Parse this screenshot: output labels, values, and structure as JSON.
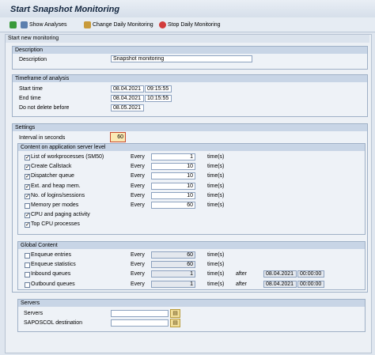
{
  "title": "Start Snapshot Monitoring",
  "toolbar": {
    "show_analyses": "Show Analyses",
    "change_daily": "Change Daily Monitoring",
    "stop_daily": "Stop Daily Monitoring"
  },
  "panel_header": "Start new monitoring",
  "description": {
    "group": "Description",
    "label": "Description",
    "value": "Snapshot monitoring"
  },
  "timeframe": {
    "group": "Timeframe of analysis",
    "start_label": "Start time",
    "start_date": "08.04.2021",
    "start_time": "09:15:55",
    "end_label": "End time",
    "end_date": "08.04.2021",
    "end_time": "10:15:55",
    "nodelete_label": "Do not delete before",
    "nodelete_date": "08.05.2021"
  },
  "settings": {
    "group": "Settings",
    "interval_label": "Interval in seconds",
    "interval_value": "60",
    "app_group": "Content on application server level",
    "every": "Every",
    "times": "time(s)",
    "app_rows": [
      {
        "label": "List of workprocesses (SM50)",
        "checked": true,
        "value": "1"
      },
      {
        "label": "Create Callstack",
        "checked": true,
        "value": "10"
      },
      {
        "label": "Dispatcher queue",
        "checked": true,
        "value": "10"
      },
      {
        "label": "Ext. and heap mem.",
        "checked": true,
        "value": "10"
      },
      {
        "label": "No. of logins/sessions",
        "checked": true,
        "value": "10"
      },
      {
        "label": "Memory per modes",
        "checked": false,
        "value": "60"
      },
      {
        "label": "CPU and paging activity",
        "checked": true,
        "value": ""
      },
      {
        "label": "Top CPU processes",
        "checked": true,
        "value": ""
      }
    ],
    "global_group": "Global Content",
    "after": "after",
    "global_rows": [
      {
        "label": "Enqueue entries",
        "value": "60",
        "after_date": "",
        "after_time": ""
      },
      {
        "label": "Enqueue statistics",
        "value": "60",
        "after_date": "",
        "after_time": ""
      },
      {
        "label": "Inbound queues",
        "value": "1",
        "after_date": "08.04.2021",
        "after_time": "00:00:00"
      },
      {
        "label": "Outbound queues",
        "value": "1",
        "after_date": "08.04.2021",
        "after_time": "00:00:00"
      }
    ]
  },
  "servers": {
    "group": "Servers",
    "servers_label": "Servers",
    "saposcol_label": "SAPOSCOL destination"
  },
  "colors": {
    "title": "#13263f",
    "group_header": "#c8d5e6",
    "f4_help": "#f2df9a"
  }
}
